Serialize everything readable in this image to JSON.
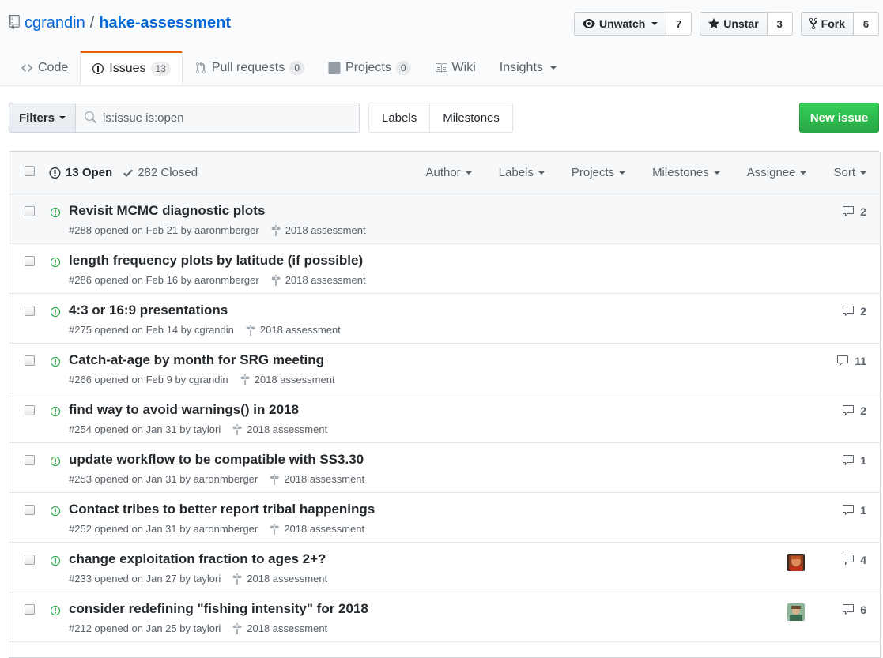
{
  "repo": {
    "owner": "cgrandin",
    "separator": "/",
    "name": "hake-assessment"
  },
  "actions": {
    "watch": {
      "label": "Unwatch",
      "count": "7"
    },
    "star": {
      "label": "Unstar",
      "count": "3"
    },
    "fork": {
      "label": "Fork",
      "count": "6"
    }
  },
  "reponav": {
    "code": "Code",
    "issues": "Issues",
    "issues_count": "13",
    "pulls": "Pull requests",
    "pulls_count": "0",
    "projects": "Projects",
    "projects_count": "0",
    "wiki": "Wiki",
    "insights": "Insights"
  },
  "subnav": {
    "filters": "Filters",
    "search_value": "is:issue is:open",
    "labels": "Labels",
    "milestones": "Milestones",
    "new_issue": "New issue"
  },
  "box_header": {
    "open": "13 Open",
    "closed": "282 Closed",
    "filters": [
      "Author",
      "Labels",
      "Projects",
      "Milestones",
      "Assignee",
      "Sort"
    ]
  },
  "issues": [
    {
      "title": "Revisit MCMC diagnostic plots",
      "meta": "#288 opened on Feb 21 by aaronmberger",
      "milestone": "2018 assessment",
      "comments": "2",
      "avatar": ""
    },
    {
      "title": "length frequency plots by latitude (if possible)",
      "meta": "#286 opened on Feb 16 by aaronmberger",
      "milestone": "2018 assessment",
      "comments": "",
      "avatar": ""
    },
    {
      "title": "4:3 or 16:9 presentations",
      "meta": "#275 opened on Feb 14 by cgrandin",
      "milestone": "2018 assessment",
      "comments": "2",
      "avatar": ""
    },
    {
      "title": "Catch-at-age by month for SRG meeting",
      "meta": "#266 opened on Feb 9 by cgrandin",
      "milestone": "2018 assessment",
      "comments": "11",
      "avatar": ""
    },
    {
      "title": "find way to avoid warnings() in 2018",
      "meta": "#254 opened on Jan 31 by taylori",
      "milestone": "2018 assessment",
      "comments": "2",
      "avatar": ""
    },
    {
      "title": "update workflow to be compatible with SS3.30",
      "meta": "#253 opened on Jan 31 by aaronmberger",
      "milestone": "2018 assessment",
      "comments": "1",
      "avatar": ""
    },
    {
      "title": "Contact tribes to better report tribal happenings",
      "meta": "#252 opened on Jan 31 by aaronmberger",
      "milestone": "2018 assessment",
      "comments": "1",
      "avatar": ""
    },
    {
      "title": "change exploitation fraction to ages 2+?",
      "meta": "#233 opened on Jan 27 by taylori",
      "milestone": "2018 assessment",
      "comments": "4",
      "avatar": "red"
    },
    {
      "title": "consider redefining \"fishing intensity\" for 2018",
      "meta": "#212 opened on Jan 25 by taylori",
      "milestone": "2018 assessment",
      "comments": "6",
      "avatar": "green"
    }
  ],
  "colors": {
    "link": "#0366d6",
    "open_icon": "#28a745",
    "new_issue_bg": "#28a745",
    "selected_tab": "#e36209"
  }
}
